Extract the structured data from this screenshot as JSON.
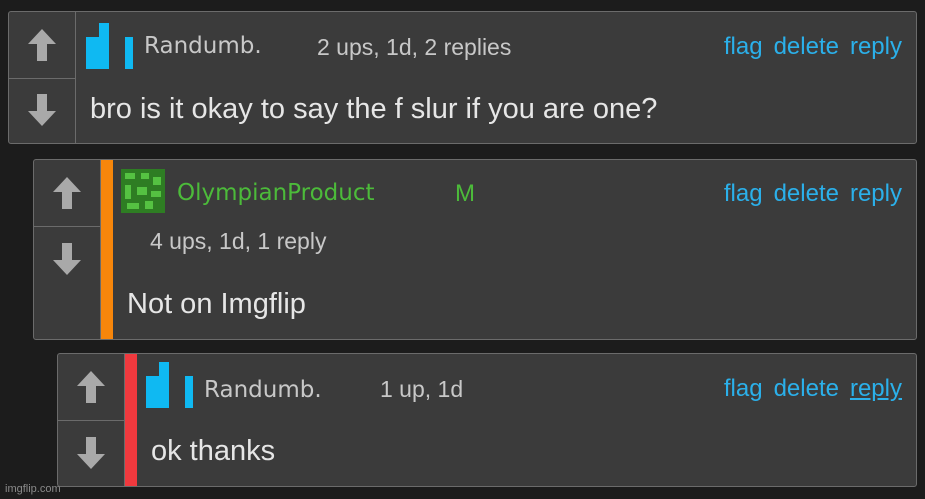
{
  "comments": [
    {
      "username": "Randumb.",
      "meta": "2 ups, 1d, 2 replies",
      "actions": [
        "flag",
        "delete",
        "reply"
      ],
      "text": "bro is it okay to say the f slur if you are one?"
    },
    {
      "username": "OlympianProduct",
      "badge": "M",
      "meta": "4 ups, 1d, 1 reply",
      "actions": [
        "flag",
        "delete",
        "reply"
      ],
      "text": "Not on Imgflip",
      "bar_color": "#f7860b"
    },
    {
      "username": "Randumb.",
      "meta": "1 up, 1d",
      "actions": [
        "flag",
        "delete",
        "reply"
      ],
      "text": "ok thanks",
      "bar_color": "#f0393e"
    }
  ],
  "watermark": "imgflip.com",
  "colors": {
    "link": "#2bb0ea",
    "mod_green": "#4cbb3a",
    "avatar_blue": "#0fb9f2"
  },
  "icons": {
    "upvote": "arrow-up-icon",
    "downvote": "arrow-down-icon"
  }
}
